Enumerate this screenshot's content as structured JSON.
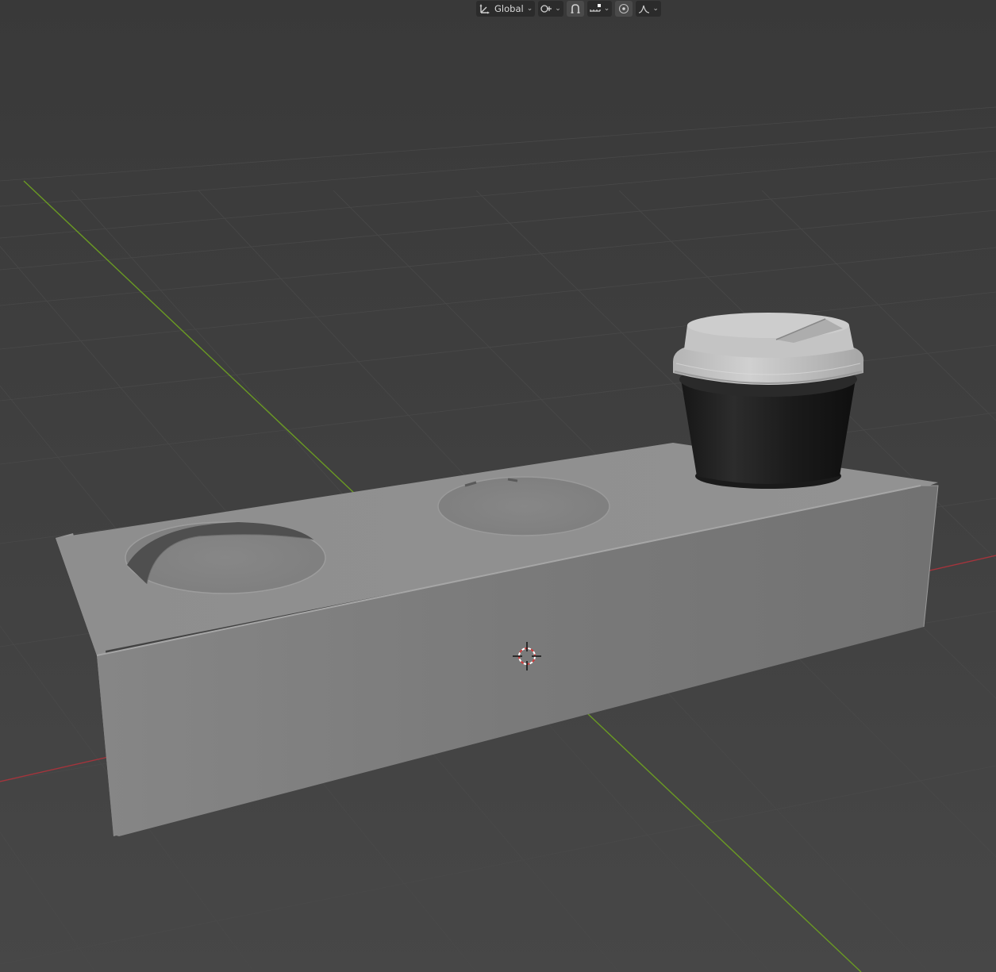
{
  "header": {
    "orientation": {
      "icon": "transform-orientation-icon",
      "label": "Global"
    },
    "pivot_icon": "pivot-point-icon",
    "snap_icon": "snap-magnet-icon",
    "snap_target_icon": "snap-increment-icon",
    "proportional_icon": "proportional-editing-icon",
    "falloff_icon": "falloff-curve-icon"
  },
  "scene": {
    "axis_colors": {
      "x": "#a5343c",
      "y": "#6a9a23"
    },
    "tray_color": "#8a8a8a",
    "cup_color": "#1e1e1e",
    "lid_color": "#c4c4c4"
  }
}
